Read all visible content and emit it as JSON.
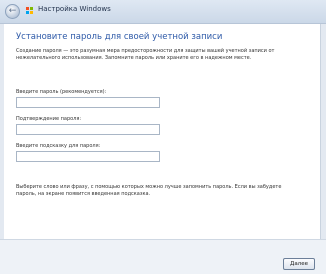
{
  "window": {
    "title": "Настройка Windows"
  },
  "page": {
    "heading": "Установите пароль для своей учетной записи",
    "description": "Создание пароля — это разумная мера предосторожности для защиты вашей учетной записи от нежелательного использования. Запомните пароль или храните его в надежном месте."
  },
  "form": {
    "password_label": "Введите пароль (рекомендуется):",
    "password_value": "",
    "confirm_label": "Подтверждение пароля:",
    "confirm_value": "",
    "hint_label": "Введите подсказку для пароля:",
    "hint_value": ""
  },
  "hint_text": "Выберите слово или фразу, с помощью которых можно лучше запомнить пароль. Если вы забудете пароль, на экране появится введенная подсказка.",
  "footer": {
    "next_label": "Далее"
  },
  "icons": {
    "back": "back-arrow-icon",
    "windows": "windows-logo-icon"
  }
}
